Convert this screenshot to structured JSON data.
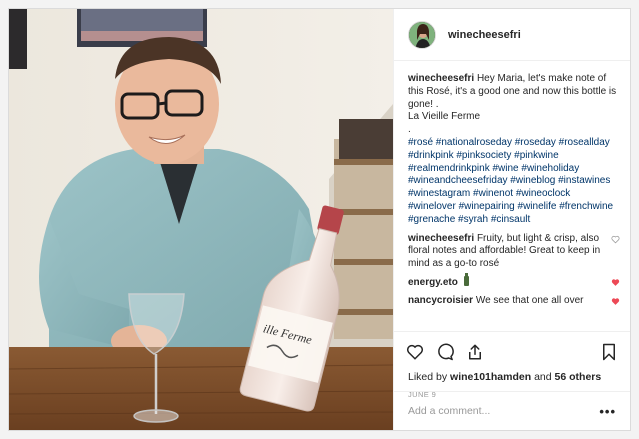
{
  "post": {
    "username": "winecheesefri",
    "caption": {
      "user": "winecheesefri",
      "text": "Hey Maria, let's make note of this Rosé, it's a good one and now this bottle is gone! .",
      "line2": "La Vieille Ferme",
      "line3": ".",
      "hashtags": "#rosé #nationalroseday #roseday #roseallday #drinkpink #pinksociety #pinkwine #realmendrinkpink #wine #wineholiday #wineandcheesefriday #wineblog #instawines #winestagram #winenot #wineoclock #winelover #winepairing #winelife #frenchwine #grenache #syrah #cinsault"
    },
    "comments": [
      {
        "user": "winecheesefri",
        "text": "Fruity, but light & crisp, also floral notes and affordable! Great to keep in mind as a go-to rosé",
        "liked": false
      },
      {
        "user": "energy.eto",
        "text": "",
        "liked": true
      },
      {
        "user": "nancycroisier",
        "text": "We see that one all over",
        "liked": true
      }
    ],
    "likes": {
      "prefix": "Liked by",
      "user": "wine101hamden",
      "and": "and",
      "count": "56 others"
    },
    "date": "JUNE 9",
    "add_comment_placeholder": "Add a comment...",
    "more": "•••",
    "colors": {
      "like_red": "#ed4956",
      "hashtag": "#003569"
    },
    "icons": [
      "heart-icon",
      "comment-icon",
      "share-icon",
      "bookmark-icon"
    ]
  },
  "photo": {
    "bottle_label": "ille Ferme"
  }
}
